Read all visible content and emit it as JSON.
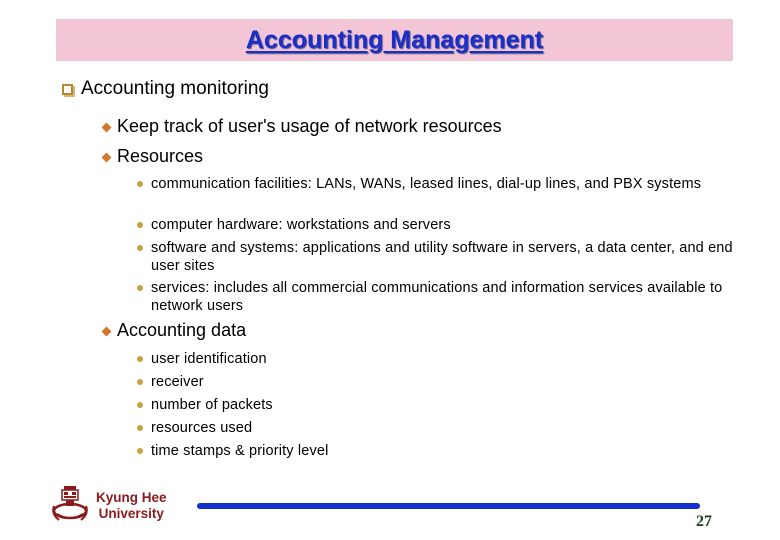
{
  "slide": {
    "title": "Accounting Management",
    "section": {
      "heading": "Accounting monitoring",
      "items": [
        {
          "label": "Keep track of user's usage of network resources"
        },
        {
          "label": "Resources",
          "subitems": [
            "communication facilities: LANs, WANs, leased lines, dial-up lines, and PBX systems",
            "computer hardware: workstations and servers",
            "software and systems: applications and utility software in servers, a data center, and end user sites",
            "services: includes all commercial communications and information services available to network users"
          ]
        },
        {
          "label": "Accounting data",
          "subitems": [
            "user identification",
            "receiver",
            "number of packets",
            "resources used",
            "time stamps & priority level"
          ]
        }
      ]
    },
    "footer": {
      "university_line1": "Kyung Hee",
      "university_line2": "University",
      "page_number": "27",
      "logo_icon": "university-crest-icon"
    },
    "colors": {
      "title_bg": "#f2c6d6",
      "title_text": "#1a2fc8",
      "bullet_box": "#b8862c",
      "bullet_diamond": "#d4762a",
      "bullet_dot": "#c8a040",
      "footer_line": "#1030d0",
      "university_text": "#8b1a1a",
      "page_number": "#1a4020"
    }
  }
}
